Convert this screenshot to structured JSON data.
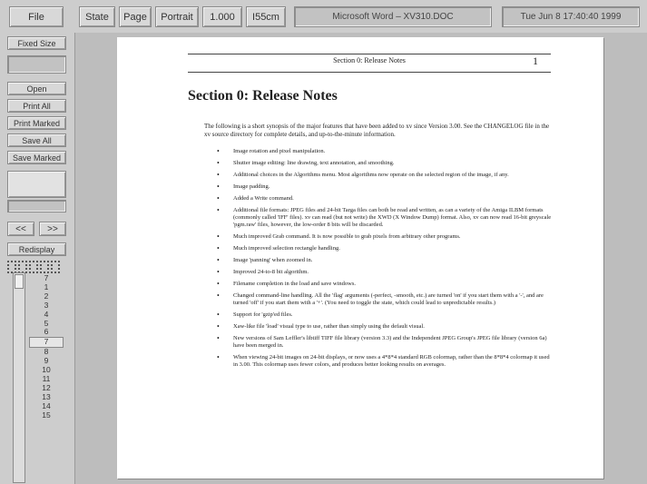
{
  "toolbar": {
    "file": "File",
    "state": "State",
    "page": "Page",
    "portrait": "Portrait",
    "zoom": "1.000",
    "unit": "I55cm",
    "title": "Microsoft Word – XV310.DOC",
    "clock": "Tue Jun  8 17:40:40 1999"
  },
  "sidebar": {
    "fixed_size": "Fixed Size",
    "open": "Open",
    "print_all": "Print All",
    "print_marked": "Print Marked",
    "save_all": "Save All",
    "save_marked": "Save Marked",
    "prev": "<<",
    "next": ">>",
    "redisplay": "Redisplay",
    "pages": [
      "7",
      "1",
      "2",
      "3",
      "4",
      "5",
      "6",
      "7",
      "8",
      "9",
      "10",
      "11",
      "12",
      "13",
      "14",
      "15"
    ],
    "selected_page": "7"
  },
  "document": {
    "running_head": "Section 0:  Release Notes",
    "page_number": "1",
    "section_title": "Section 0:  Release Notes",
    "intro": "The following is a short synopsis of the major features that have been added to xv since Version 3.00. See the CHANGELOG file in the xv source directory for complete details, and up-to-the-minute information.",
    "bullets": [
      "Image rotation and pixel manipulation.",
      "Shutter image editing: line drawing, text annotation, and smoothing.",
      "Additional choices in the Algorithms menu. Most algorithms now operate on the selected region of the image, if any.",
      "Image padding.",
      "Added a Write command.",
      "Additional file formats: JPEG files and 24-bit Targa files can both be read and written, as can a variety of the Amiga ILBM formats (commonly called 'IFF' files). xv can read (but not write) the XWD (X Window Dump) format. Also, xv can now read 16-bit greyscale 'pgm.raw' files, however, the low-order 8 bits will be discarded.",
      "Much improved Grab command. It is now possible to grab pixels from arbitrary other programs.",
      "Much improved selection rectangle handling.",
      "Image 'panning' when zoomed in.",
      "Improved 24-to-8 bit algorithm.",
      "Filename completion in the load and save windows.",
      "Changed command-line handling. All the 'flag' arguments (-perfect, -smooth, etc.) are turned 'on' if you start them with a '-', and are turned 'off' if you start them with a '+'. (You need to toggle the state, which could lead to unpredictable results.)",
      "Support for 'gzip'ed files.",
      "Xaw-like file 'load' visual type to use, rather than simply using the default visual.",
      "New versions of Sam Leffler's libtiff TIFF file library (version 3.3) and the Independent JPEG Group's JPEG file library (version 6a) have been merged in.",
      "When viewing 24-bit images on 24-bit displays, or now uses a 4*8*4 standard RGB colormap, rather than the 8*8*4 colormap it used in 3.00. This colormap uses fewer colors, and produces better looking results on averages."
    ]
  },
  "colors": {
    "background": "#c9c9c9",
    "page": "#ffffff",
    "button": "#d8d8d8"
  }
}
